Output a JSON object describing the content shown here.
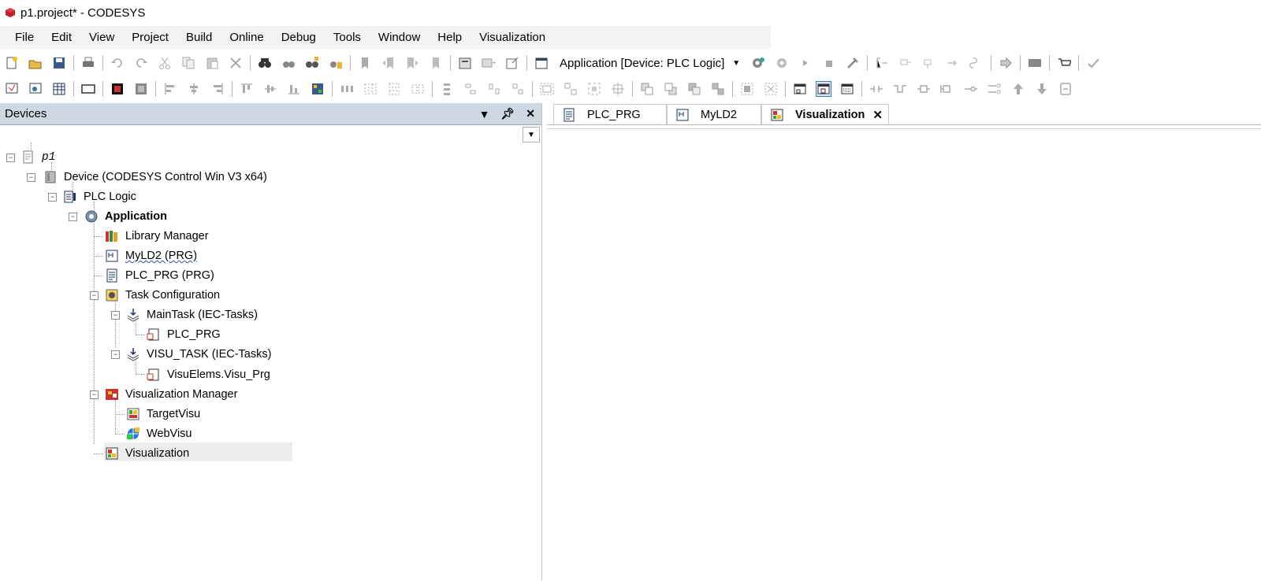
{
  "window": {
    "title": "p1.project* - CODESYS"
  },
  "menu": [
    "File",
    "Edit",
    "View",
    "Project",
    "Build",
    "Online",
    "Debug",
    "Tools",
    "Window",
    "Help",
    "Visualization"
  ],
  "toolbar": {
    "active_application": "Application [Device: PLC Logic]"
  },
  "devices_panel": {
    "title": "Devices"
  },
  "tree": {
    "root": "p1",
    "device": "Device (CODESYS Control Win V3 x64)",
    "plc_logic": "PLC Logic",
    "application": "Application",
    "library_manager": "Library Manager",
    "myld2": "MyLD2 (PRG)",
    "plc_prg": "PLC_PRG (PRG)",
    "task_config": "Task Configuration",
    "main_task": "MainTask (IEC-Tasks)",
    "main_task_call": "PLC_PRG",
    "visu_task": "VISU_TASK (IEC-Tasks)",
    "visu_task_call": "VisuElems.Visu_Prg",
    "visu_manager": "Visualization Manager",
    "target_visu": "TargetVisu",
    "web_visu": "WebVisu",
    "visualization": "Visualization"
  },
  "editor_tabs": [
    {
      "label": "PLC_PRG",
      "icon": "st-program-icon"
    },
    {
      "label": "MyLD2",
      "icon": "ld-program-icon"
    },
    {
      "label": "Visualization",
      "icon": "visualization-icon",
      "active": true
    }
  ]
}
